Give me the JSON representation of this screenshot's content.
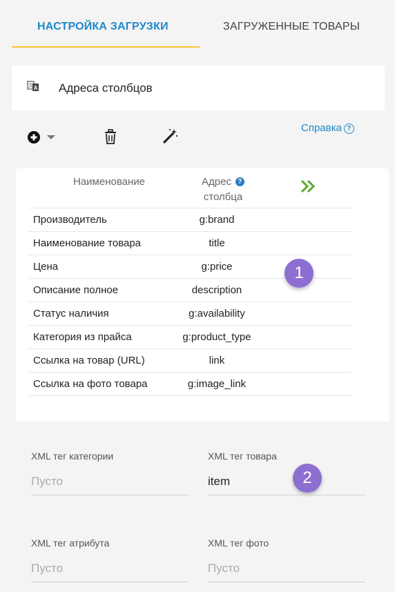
{
  "tabs": [
    {
      "label": "НАСТРОЙКА ЗАГРУЗКИ"
    },
    {
      "label": "ЗАГРУЖЕННЫЕ ТОВАРЫ"
    }
  ],
  "panel": {
    "title": "Адреса столбцов",
    "icon": "translate-icon"
  },
  "toolbar": {
    "add_icon": "plus-circle-icon",
    "trash_icon": "trash-icon",
    "magic_icon": "magic-wand-icon",
    "help_label": "Справка"
  },
  "table": {
    "headers": {
      "name": "Наименование",
      "address_line1": "Адрес",
      "address_line2": "столбца"
    },
    "rows": [
      {
        "name": "Производитель",
        "address": "g:brand"
      },
      {
        "name": "Наименование товара",
        "address": "title"
      },
      {
        "name": "Цена",
        "address": "g:price"
      },
      {
        "name": "Описание полное",
        "address": "description"
      },
      {
        "name": "Статус наличия",
        "address": "g:availability"
      },
      {
        "name": "Категория из прайса",
        "address": "g:product_type"
      },
      {
        "name": "Ссылка на товар (URL)",
        "address": "link"
      },
      {
        "name": "Ссылка на фото товара",
        "address": "g:image_link"
      }
    ]
  },
  "badges": [
    "1",
    "2"
  ],
  "fields": [
    {
      "label": "XML тег категории",
      "value": "",
      "placeholder": "Пусто"
    },
    {
      "label": "XML тег товара",
      "value": "item",
      "placeholder": "Пусто"
    },
    {
      "label": "XML тег атрибута",
      "value": "",
      "placeholder": "Пусто"
    },
    {
      "label": "XML тег фото",
      "value": "",
      "placeholder": "Пусто"
    }
  ],
  "colors": {
    "accent": "#1e88c9",
    "tab_underline": "#f5c32c",
    "badge": "#8d6fd1",
    "expand": "#5aa832"
  }
}
